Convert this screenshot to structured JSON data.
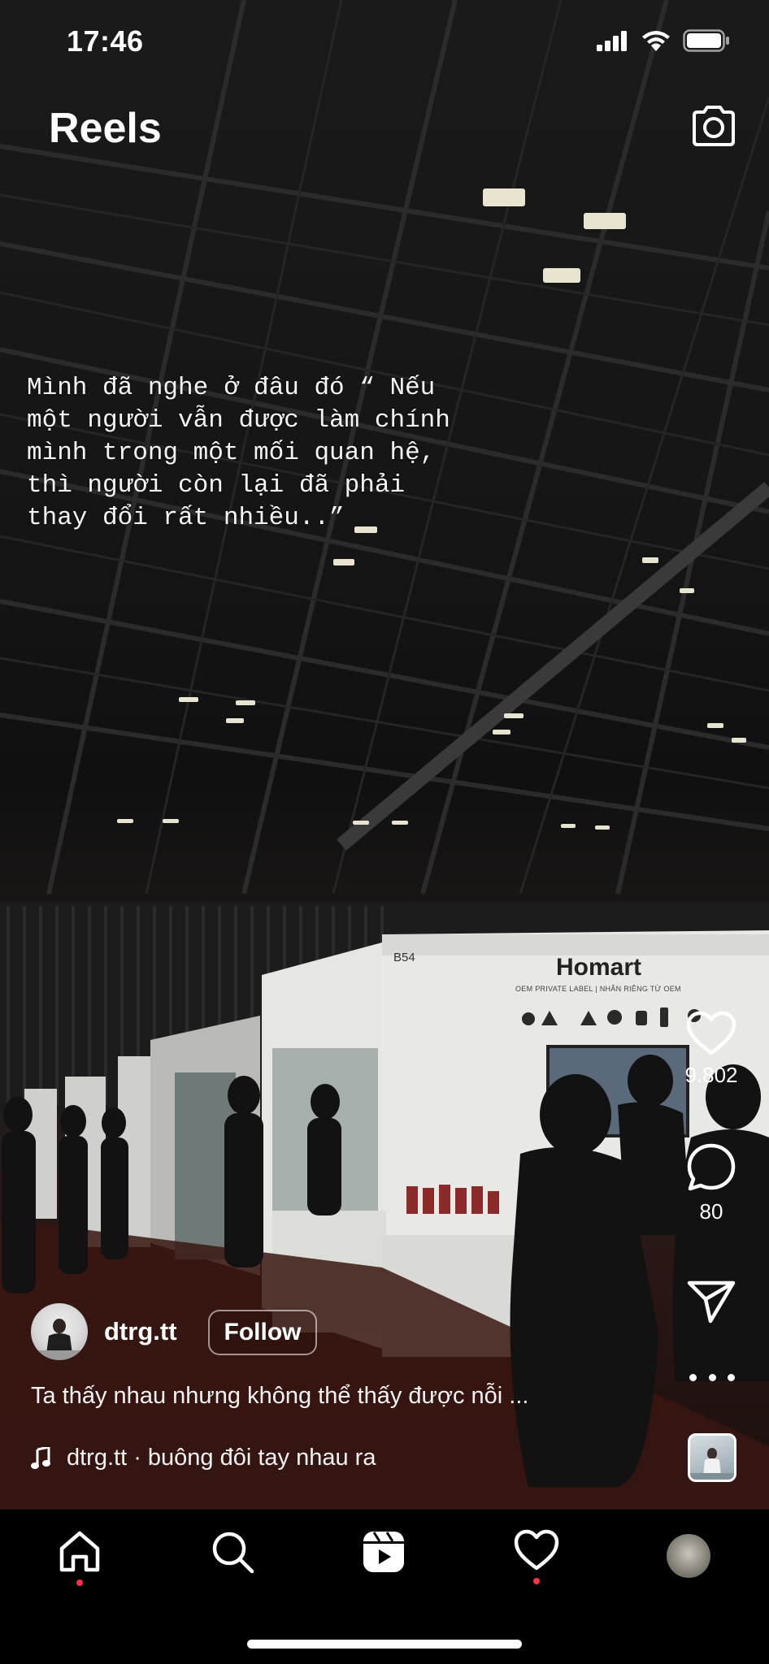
{
  "status_bar": {
    "time": "17:46",
    "icons": [
      "cellular-signal-icon",
      "wifi-icon",
      "battery-icon"
    ]
  },
  "header": {
    "title": "Reels",
    "camera_icon": "camera-icon"
  },
  "reel": {
    "overlay_text": "Mình đã nghe ở đâu đó “ Nếu\nmột người vẫn được làm chính\nmình trong một mối quan hệ,\nthì người còn lại đã phải\nthay đổi rất nhiều..”",
    "booth_sign": "Homart",
    "booth_number": "B54",
    "booth_subtitle": "OEM PRIVATE LABEL | NHÃN RIÊNG TỪ OEM",
    "author": {
      "username": "dtrg.tt",
      "follow_label": "Follow"
    },
    "caption": "Ta thấy nhau nhưng không thể thấy được nỗi ...",
    "audio": {
      "icon": "music-note-icon",
      "label": "dtrg.tt · buông đôi tay nhau ra"
    },
    "actions": {
      "likes": "9.802",
      "comments": "80",
      "like_icon": "heart-icon",
      "comment_icon": "comment-icon",
      "share_icon": "send-icon",
      "more_icon": "more-icon"
    }
  },
  "bottom_nav": {
    "items": [
      "home-icon",
      "search-icon",
      "reels-icon",
      "activity-heart-icon",
      "profile-avatar"
    ],
    "notification_color": "#ff3040"
  },
  "colors": {
    "background": "#000000",
    "text": "#ffffff",
    "notification_dot": "#ff3040"
  }
}
